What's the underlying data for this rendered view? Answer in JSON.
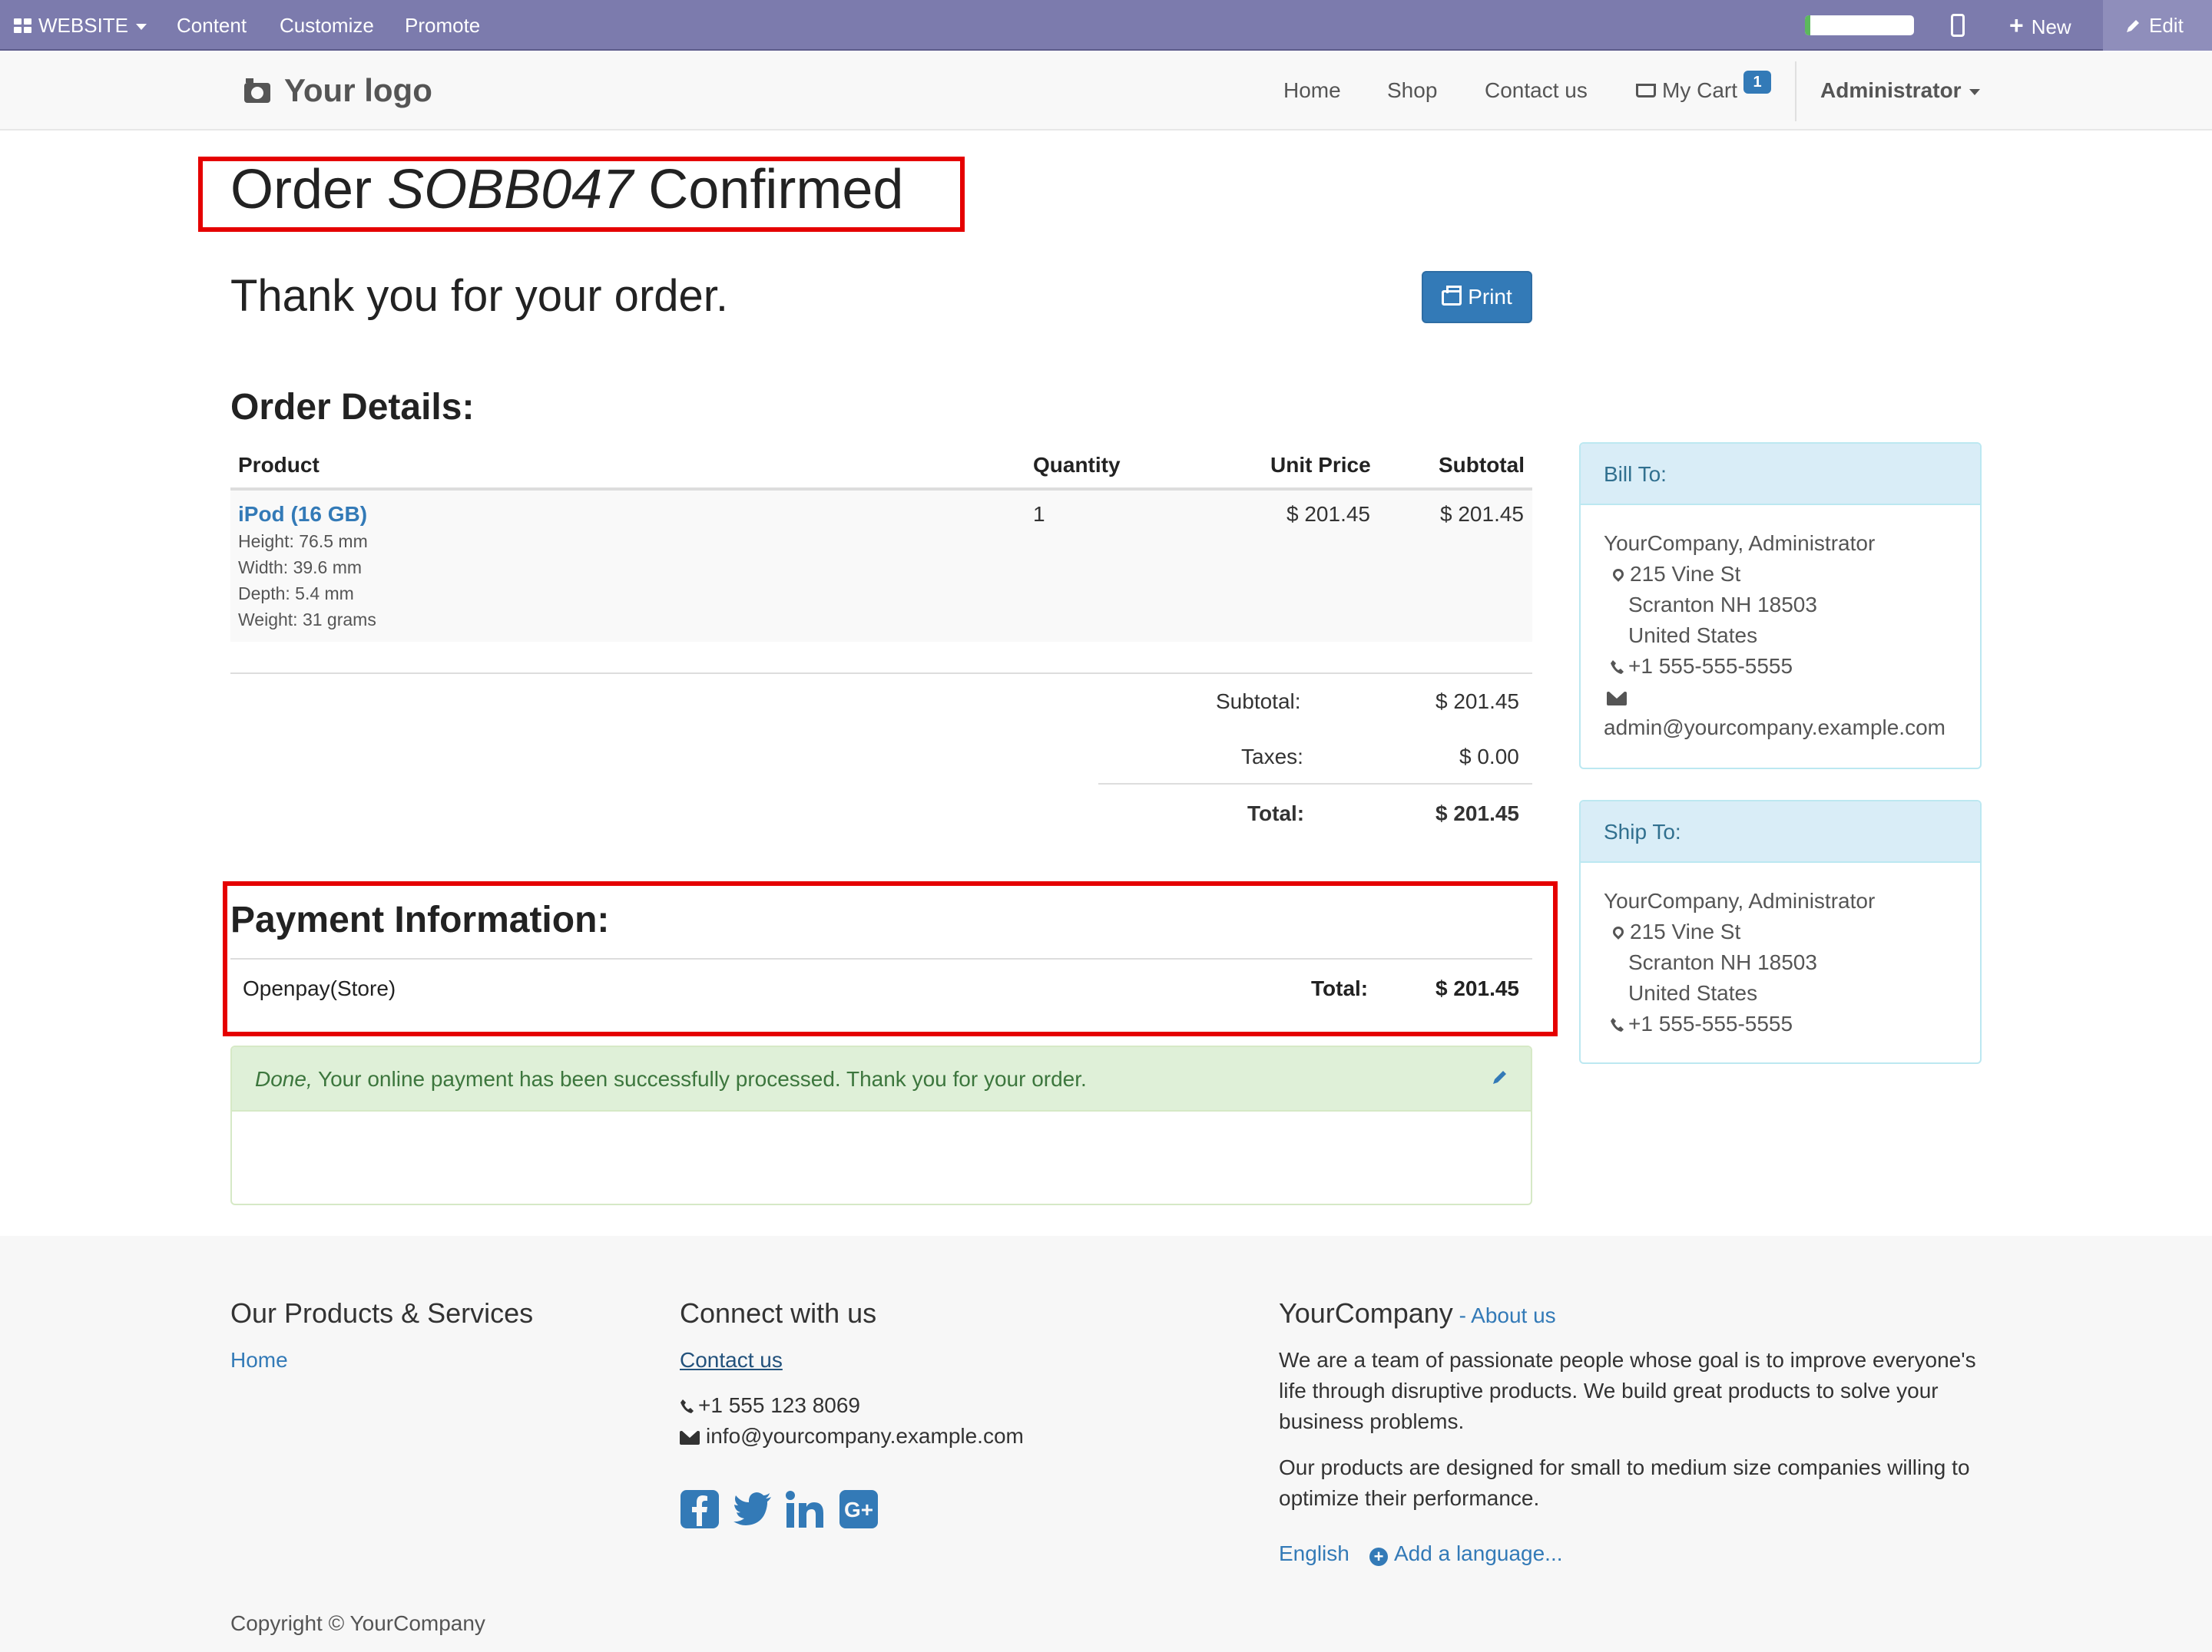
{
  "admin_bar": {
    "website_menu": "WEBSITE",
    "content_menu": "Content",
    "customize_menu": "Customize",
    "promote_menu": "Promote",
    "progress_fraction": 0.05,
    "new_label": "New",
    "edit_label": "Edit",
    "colors": {
      "bar": "#7c7bad",
      "progress_fill": "#5cb85c"
    }
  },
  "navbar": {
    "logo_text": "Your logo",
    "links": {
      "home": "Home",
      "shop": "Shop",
      "contact": "Contact us",
      "cart": "My Cart"
    },
    "cart_count": "1",
    "user_menu": "Administrator"
  },
  "order": {
    "title_prefix": "Order",
    "order_ref": "SOBB047",
    "title_suffix": "Confirmed",
    "thank_you": "Thank you for your order.",
    "print_label": "Print",
    "details_heading": "Order Details:",
    "columns": {
      "product": "Product",
      "quantity": "Quantity",
      "unit_price": "Unit Price",
      "subtotal": "Subtotal"
    },
    "line": {
      "product_name": "iPod (16 GB)",
      "attributes": [
        "Height: 76.5 mm",
        "Width: 39.6 mm",
        "Depth: 5.4 mm",
        "Weight: 31 grams"
      ],
      "quantity": "1",
      "unit_price": "$ 201.45",
      "subtotal": "$ 201.45"
    },
    "summary": {
      "subtotal_label": "Subtotal:",
      "subtotal_value": "$ 201.45",
      "taxes_label": "Taxes:",
      "taxes_value": "$ 0.00",
      "total_label": "Total:",
      "total_value": "$ 201.45"
    }
  },
  "payment": {
    "heading": "Payment Information:",
    "method": "Openpay(Store)",
    "total_label": "Total:",
    "total_value": "$ 201.45",
    "status_emphasis": "Done,",
    "status_message": "Your online payment has been successfully processed. Thank you for your order."
  },
  "bill_to": {
    "heading": "Bill To:",
    "name": "YourCompany, Administrator",
    "street": "215 Vine St",
    "city_line": "Scranton NH 18503",
    "country": "United States",
    "phone": "+1 555-555-5555",
    "email": "admin@yourcompany.example.com"
  },
  "ship_to": {
    "heading": "Ship To:",
    "name": "YourCompany, Administrator",
    "street": "215 Vine St",
    "city_line": "Scranton NH 18503",
    "country": "United States",
    "phone": "+1 555-555-5555"
  },
  "footer": {
    "products_heading": "Our Products & Services",
    "products_home": "Home",
    "connect_heading": "Connect with us",
    "contact_link": "Contact us",
    "phone": "+1 555 123 8069",
    "email": "info@yourcompany.example.com",
    "company_name": "YourCompany",
    "about_link": "About us",
    "about_dash": " - ",
    "about_p1": "We are a team of passionate people whose goal is to improve everyone's life through disruptive products. We build great products to solve your business problems.",
    "about_p2": "Our products are designed for small to medium size companies willing to optimize their performance.",
    "language": "English",
    "add_language": "Add a language...",
    "copyright": "Copyright © YourCompany",
    "social_icons": [
      "facebook-icon",
      "twitter-icon",
      "linkedin-icon",
      "google-plus-icon"
    ]
  },
  "colors": {
    "link": "#337ab7",
    "highlight_border": "#e50000",
    "success_bg": "#dff0d8",
    "success_text": "#3c763d",
    "info_bg": "#d9edf7",
    "info_text": "#31708f"
  }
}
